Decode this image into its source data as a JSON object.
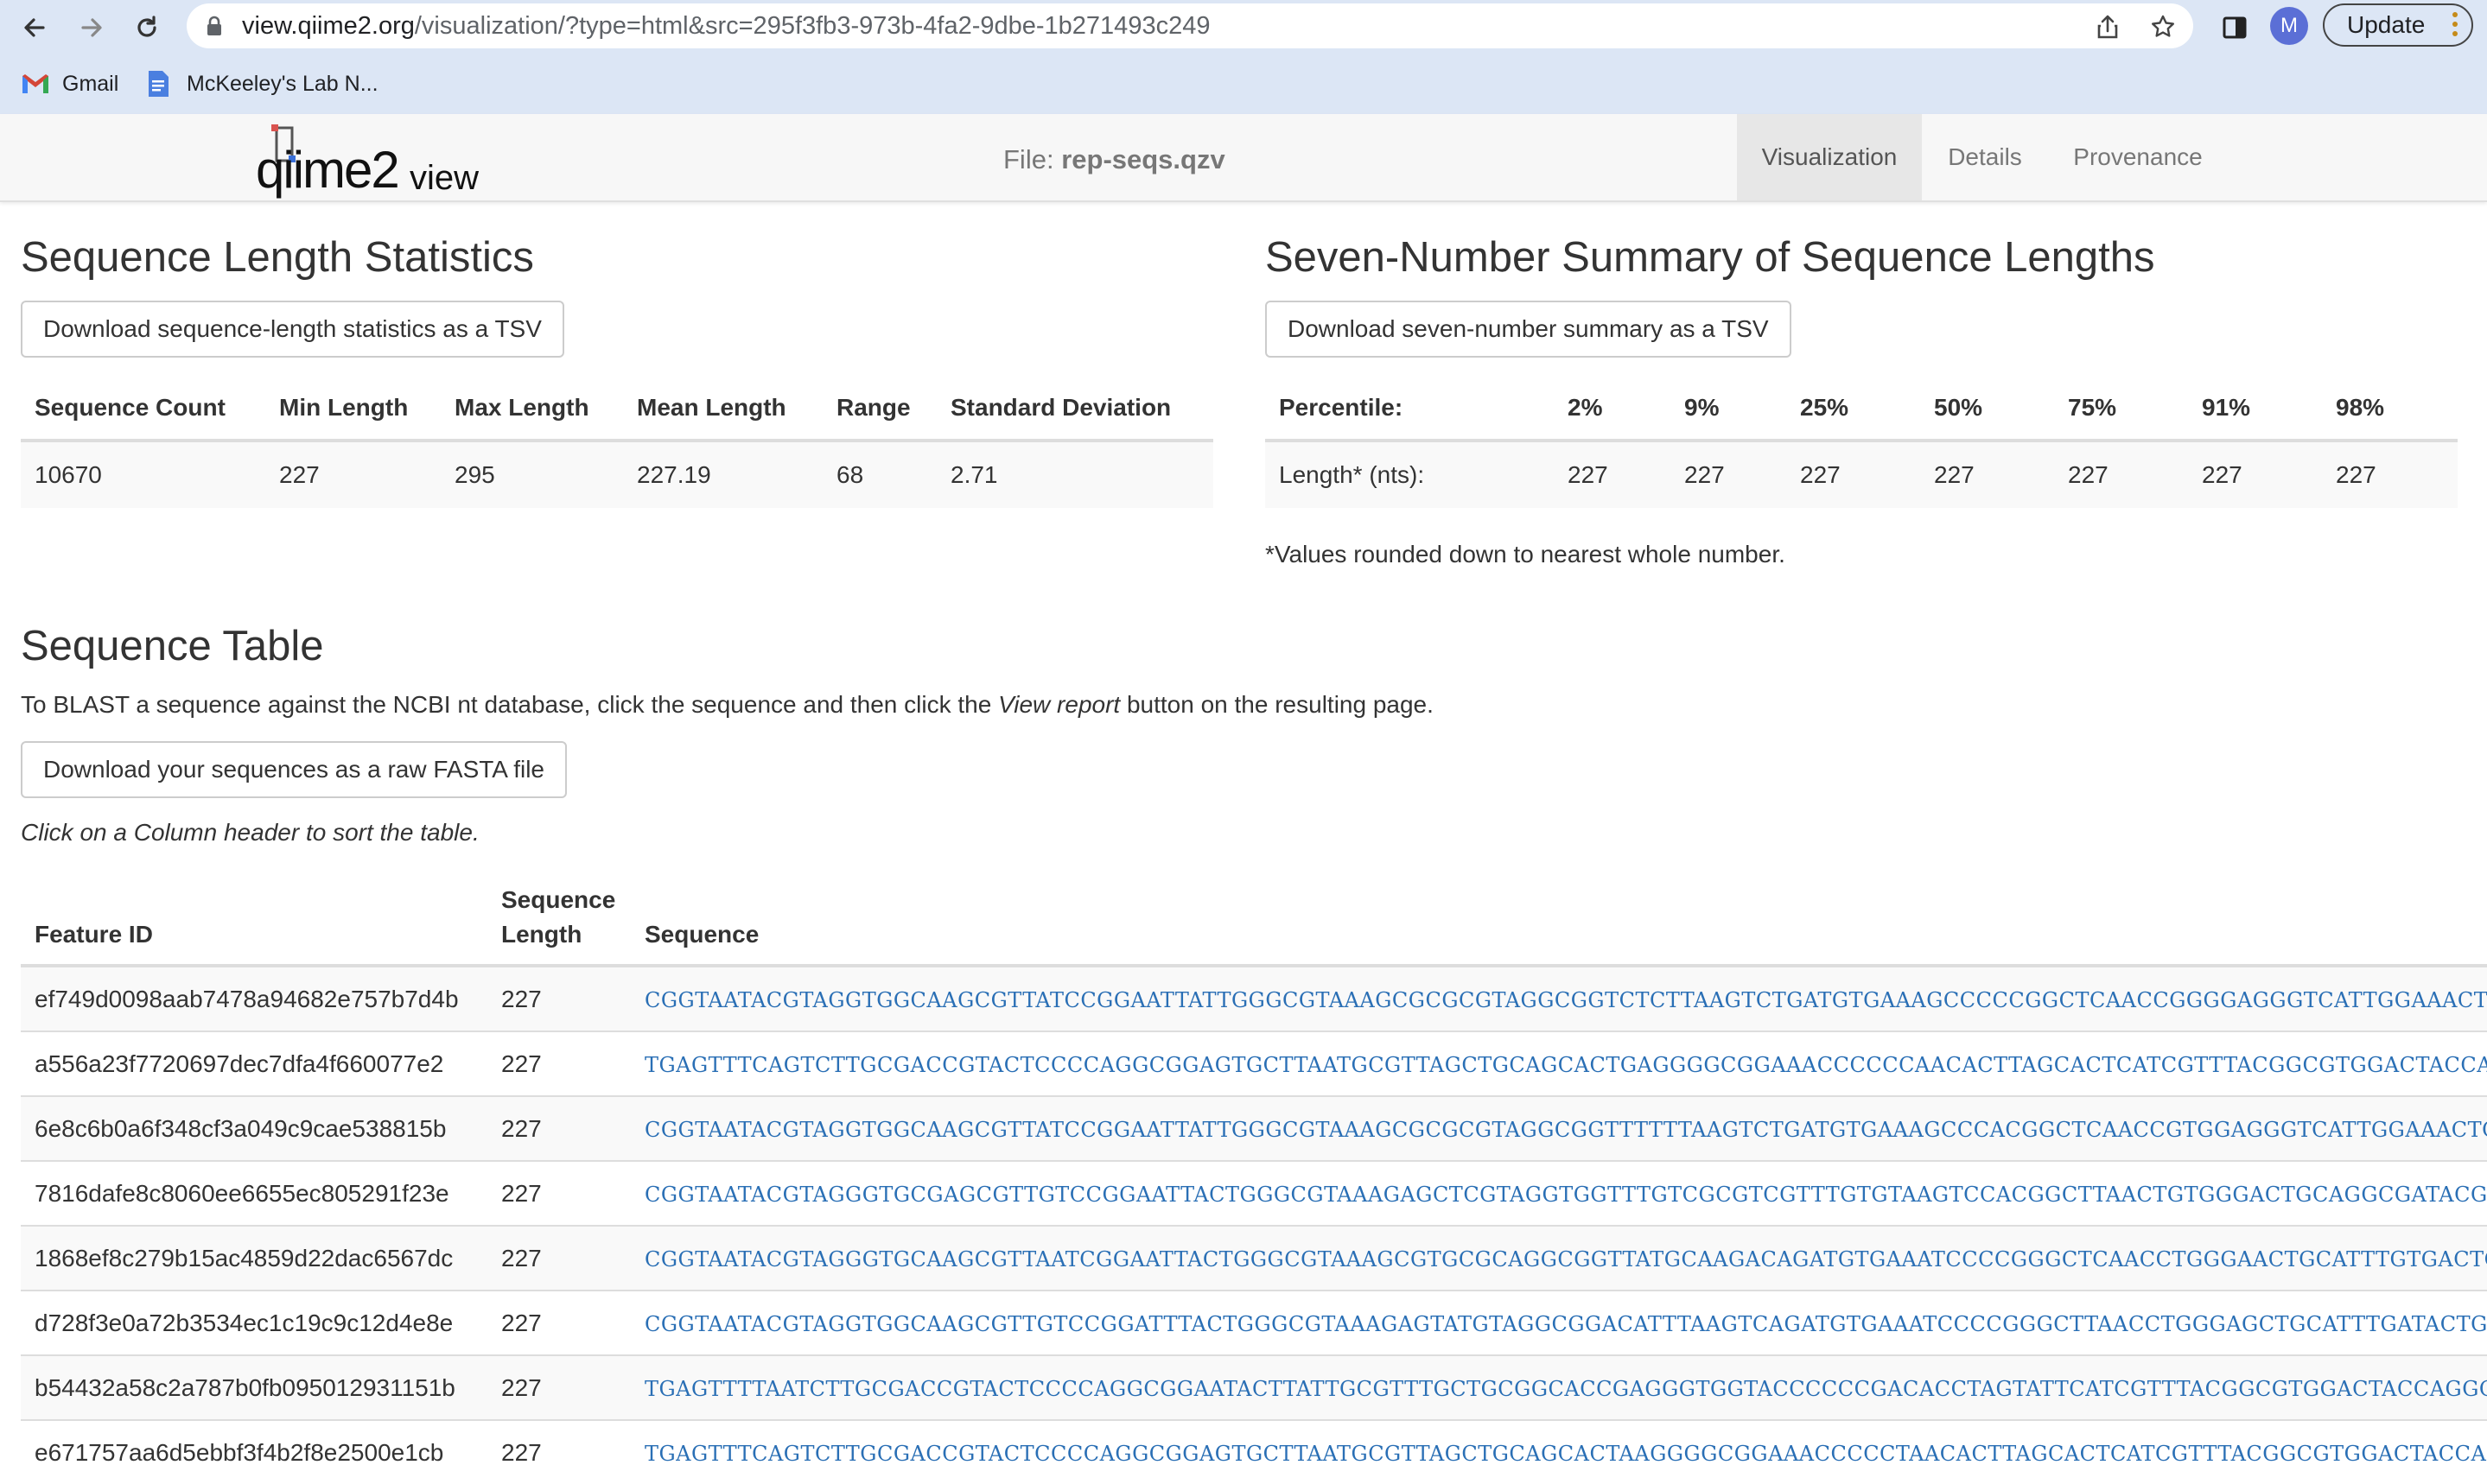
{
  "browser": {
    "url_host": "view.qiime2.org",
    "url_path": "/visualization/?type=html&src=295f3fb3-973b-4fa2-9dbe-1b271493c249",
    "avatar_letter": "M",
    "update_label": "Update",
    "bookmarks": [
      {
        "label": "Gmail",
        "icon": "gmail-icon"
      },
      {
        "label": "McKeeley's Lab N...",
        "icon": "google-docs-icon"
      }
    ]
  },
  "header": {
    "logo_main": "qiime2",
    "logo_sub": "view",
    "file_prefix": "File:",
    "file_name": "rep-seqs.qzv",
    "tabs": [
      {
        "label": "Visualization",
        "active": true
      },
      {
        "label": "Details",
        "active": false
      },
      {
        "label": "Provenance",
        "active": false
      }
    ]
  },
  "length_stats": {
    "title": "Sequence Length Statistics",
    "download_label": "Download sequence-length statistics as a TSV",
    "headers": [
      "Sequence Count",
      "Min Length",
      "Max Length",
      "Mean Length",
      "Range",
      "Standard Deviation"
    ],
    "values": [
      "10670",
      "227",
      "295",
      "227.19",
      "68",
      "2.71"
    ]
  },
  "seven_number": {
    "title": "Seven-Number Summary of Sequence Lengths",
    "download_label": "Download seven-number summary as a TSV",
    "headers": [
      "Percentile:",
      "2%",
      "9%",
      "25%",
      "50%",
      "75%",
      "91%",
      "98%"
    ],
    "values": [
      "Length* (nts):",
      "227",
      "227",
      "227",
      "227",
      "227",
      "227",
      "227"
    ],
    "footnote": "*Values rounded down to nearest whole number."
  },
  "sequence_table": {
    "title": "Sequence Table",
    "blast_before": "To BLAST a sequence against the NCBI nt database, click the sequence and then click the ",
    "blast_italic": "View report",
    "blast_after": " button on the resulting page.",
    "download_label": "Download your sequences as a raw FASTA file",
    "sort_hint": "Click on a Column header to sort the table.",
    "headers": {
      "feature_id": "Feature ID",
      "length_line1": "Sequence",
      "length_line2": "Length",
      "sequence": "Sequence"
    },
    "rows": [
      {
        "id": "ef749d0098aab7478a94682e757b7d4b",
        "length": "227",
        "seq": "CGGTAATACGTAGGTGGCAAGCGTTATCCGGAATTATTGGGCGTAAAGCGCGCGTAGGCGGTCTCTTAAGTCTGATGTGAAAGCCCCCGGCTCAACCGGGGAGGGTCATTGGAAACTGGGAGACTTG"
      },
      {
        "id": "a556a23f7720697dec7dfa4f660077e2",
        "length": "227",
        "seq": "TGAGTTTCAGTCTTGCGACCGTACTCCCCAGGCGGAGTGCTTAATGCGTTAGCTGCAGCACTGAGGGGCGGAAACCCCCCAACACTTAGCACTCATCGTTTACGGCGTGGACTACCAGGGTATCTAA"
      },
      {
        "id": "6e8c6b0a6f348cf3a049c9cae538815b",
        "length": "227",
        "seq": "CGGTAATACGTAGGTGGCAAGCGTTATCCGGAATTATTGGGCGTAAAGCGCGCGTAGGCGGTTTTTTAAGTCTGATGTGAAAGCCCACGGCTCAACCGTGGAGGGTCATTGGAAACTGGAAAACTTG"
      },
      {
        "id": "7816dafe8c8060ee6655ec805291f23e",
        "length": "227",
        "seq": "CGGTAATACGTAGGGTGCGAGCGTTGTCCGGAATTACTGGGCGTAAAGAGCTCGTAGGTGGTTTGTCGCGTCGTTTGTGTAAGTCCACGGCTTAACTGTGGGACTGCAGGCGATACGGGCATAACTT"
      },
      {
        "id": "1868ef8c279b15ac4859d22dac6567dc",
        "length": "227",
        "seq": "CGGTAATACGTAGGGTGCAAGCGTTAATCGGAATTACTGGGCGTAAAGCGTGCGCAGGCGGTTATGCAAGACAGATGTGAAATCCCCGGGCTCAACCTGGGAACTGCATTTGTGACTGCATGGCTAG"
      },
      {
        "id": "d728f3e0a72b3534ec1c19c9c12d4e8e",
        "length": "227",
        "seq": "CGGTAATACGTAGGTGGCAAGCGTTGTCCGGATTTACTGGGCGTAAAGAGTATGTAGGCGGACATTTAAGTCAGATGTGAAATCCCCGGGCTTAACCTGGGAGCTGCATTTGATACTGGGTGTCTAG"
      },
      {
        "id": "b54432a58c2a787b0fb095012931151b",
        "length": "227",
        "seq": "TGAGTTTTAATCTTGCGACCGTACTCCCCAGGCGGAATACTTATTGCGTTTGCTGCGGCACCGAGGGTGGTACCCCCCGACACCTAGTATTCATCGTTTACGGCGTGGACTACCAGGGTATCTAATC"
      },
      {
        "id": "e671757aa6d5ebbf3f4b2f8e2500e1cb",
        "length": "227",
        "seq": "TGAGTTTCAGTCTTGCGACCGTACTCCCCAGGCGGAGTGCTTAATGCGTTAGCTGCAGCACTAAGGGGCGGAAACCCCCTAACACTTAGCACTCATCGTTTACGGCGTGGACTACCAGGGTATCTAA"
      }
    ]
  },
  "colors": {
    "link": "#2a6fb5",
    "chrome_bg": "#dce6f5",
    "header_bg": "#f7f7f7",
    "active_tab_bg": "#e7e7e7"
  }
}
